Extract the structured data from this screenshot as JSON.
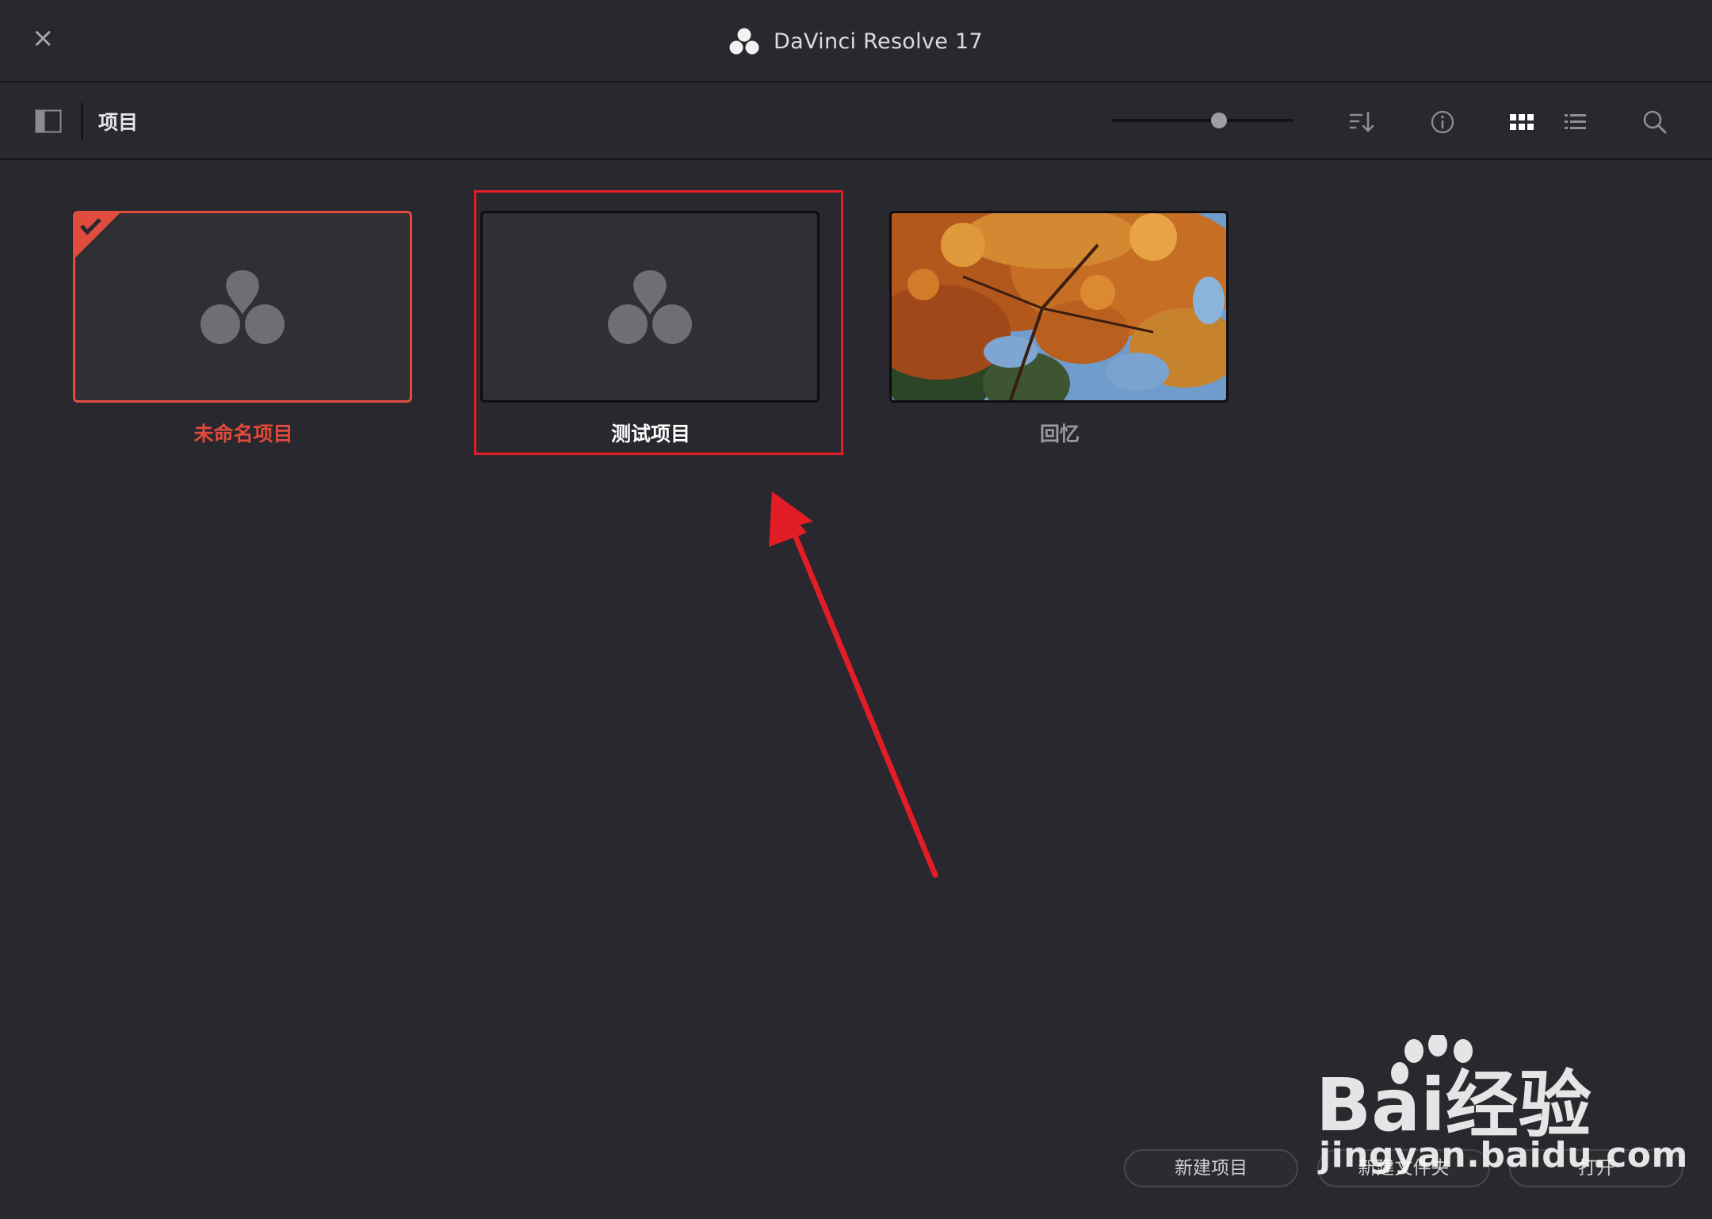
{
  "window": {
    "title": "DaVinci Resolve 17",
    "close_label": "×"
  },
  "toolbar": {
    "title": "项目",
    "zoom_level": 0.6
  },
  "projects": [
    {
      "name": "未命名项目",
      "selected": true,
      "thumbnail": "resolve-logo"
    },
    {
      "name": "测试项目",
      "selected": false,
      "thumbnail": "resolve-logo"
    },
    {
      "name": "回忆",
      "selected": false,
      "thumbnail": "autumn-leaves-photo"
    }
  ],
  "buttons": {
    "new_project": "新建项目",
    "new_folder": "新建文件夹",
    "open": "打开"
  },
  "watermark": {
    "brand": "Bai经验",
    "url": "jingyan.baidu.com"
  },
  "colors": {
    "accent_selected": "#e04d3f",
    "annotation": "#e21d26",
    "background": "#28282e"
  }
}
